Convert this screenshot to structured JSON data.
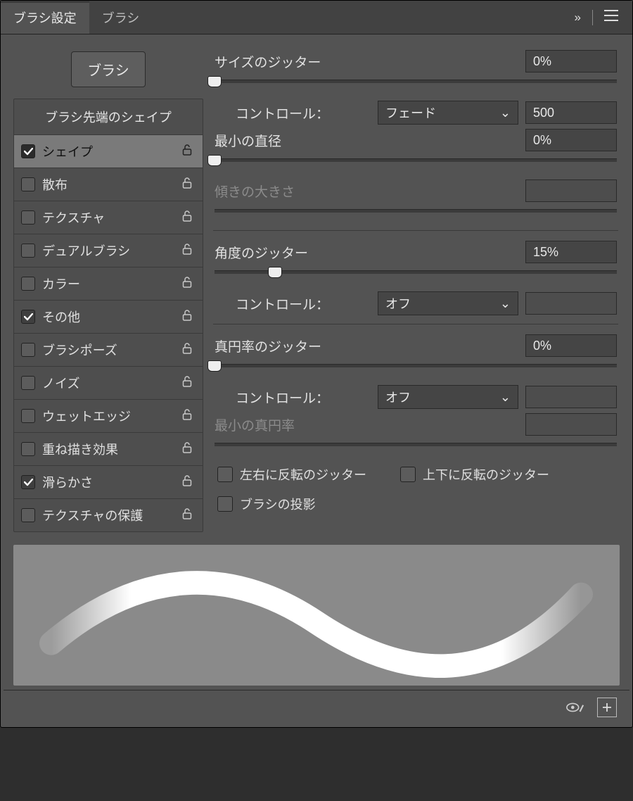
{
  "tabs": {
    "settings": "ブラシ設定",
    "brushes": "ブラシ"
  },
  "header": {
    "more": "»",
    "menu": "≡"
  },
  "sidebar": {
    "buttonLabel": "ブラシ",
    "header": "ブラシ先端のシェイプ",
    "items": [
      {
        "label": "シェイプ",
        "checked": true,
        "selected": true
      },
      {
        "label": "散布",
        "checked": false
      },
      {
        "label": "テクスチャ",
        "checked": false
      },
      {
        "label": "デュアルブラシ",
        "checked": false
      },
      {
        "label": "カラー",
        "checked": false
      },
      {
        "label": "その他",
        "checked": true
      },
      {
        "label": "ブラシポーズ",
        "checked": false
      },
      {
        "label": "ノイズ",
        "checked": false
      },
      {
        "label": "ウェットエッジ",
        "checked": false
      },
      {
        "label": "重ね描き効果",
        "checked": false
      },
      {
        "label": "滑らかさ",
        "checked": true
      },
      {
        "label": "テクスチャの保護",
        "checked": false
      }
    ]
  },
  "main": {
    "sizeJitter": {
      "label": "サイズのジッター",
      "value": "0%",
      "pos": 0
    },
    "control1": {
      "label": "コントロール：",
      "value": "フェード",
      "extra": "500"
    },
    "minDiameter": {
      "label": "最小の直径",
      "value": "0%",
      "pos": 0
    },
    "tiltScale": {
      "label": "傾きの大きさ",
      "value": "",
      "disabled": true
    },
    "angleJitter": {
      "label": "角度のジッター",
      "value": "15%",
      "pos": 15
    },
    "control2": {
      "label": "コントロール：",
      "value": "オフ",
      "extra": ""
    },
    "roundJitter": {
      "label": "真円率のジッター",
      "value": "0%",
      "pos": 0
    },
    "control3": {
      "label": "コントロール：",
      "value": "オフ",
      "extra": ""
    },
    "minRound": {
      "label": "最小の真円率",
      "value": "",
      "disabled": true
    },
    "flipX": "左右に反転のジッター",
    "flipY": "上下に反転のジッター",
    "projection": "ブラシの投影"
  }
}
